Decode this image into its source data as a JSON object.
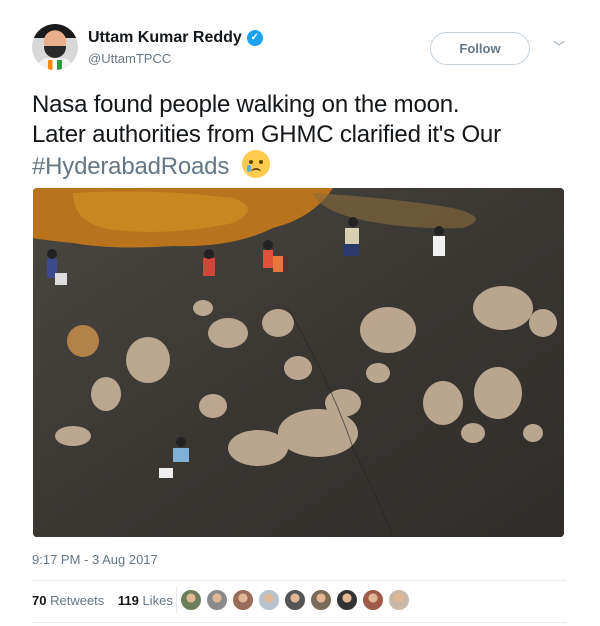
{
  "author": {
    "name": "Uttam Kumar Reddy",
    "handle": "@UttamTPCC"
  },
  "follow_label": "Follow",
  "tweet": {
    "line1": "Nasa found people walking on the moon.",
    "line2": "Later authorities from GHMC clarified it's Our",
    "hashtag": "#HyderabadRoads"
  },
  "timestamp": "9:17 PM - 3 Aug 2017",
  "stats": {
    "retweets_count": "70",
    "retweets_label": "Retweets",
    "likes_count": "119",
    "likes_label": "Likes"
  },
  "icons": {
    "verified": "verified-badge-icon",
    "caret": "chevron-down-icon",
    "emoji": "crying-face-emoji"
  },
  "colors": {
    "text": "#14171a",
    "secondary": "#657786",
    "verified": "#1da1f2",
    "border": "#e6ecf0"
  },
  "liker_colors": [
    "#6b7d5a",
    "#8a8a8a",
    "#9b6b5a",
    "#b8c2cc",
    "#555555",
    "#7a6a58",
    "#333333",
    "#a05a4a",
    "#c9b8a6"
  ]
}
